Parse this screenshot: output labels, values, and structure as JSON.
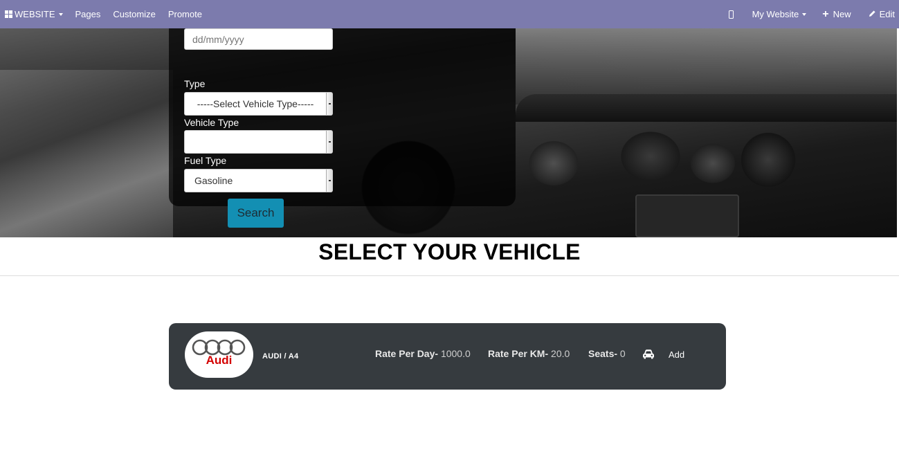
{
  "navbar": {
    "website_label": "WEBSITE",
    "pages_label": "Pages",
    "customize_label": "Customize",
    "promote_label": "Promote",
    "my_website_label": "My Website",
    "new_label": "New",
    "edit_label": "Edit",
    "background_color": "#7c7bad"
  },
  "search_form": {
    "date_placeholder": "dd/mm/yyyy",
    "type_label": "Type",
    "type_selected": "-----Select Vehicle Type-----",
    "vehicle_type_label": "Vehicle Type",
    "vehicle_type_selected": "",
    "fuel_type_label": "Fuel Type",
    "fuel_type_selected": "Gasoline",
    "search_button": "Search",
    "button_color": "#138fb3"
  },
  "section": {
    "title": "SELECT YOUR VEHICLE"
  },
  "vehicles": [
    {
      "logo_text": "Audi",
      "name": "AUDI / A4",
      "rate_per_day_label": "Rate Per Day-",
      "rate_per_day": "1000.0",
      "rate_per_km_label": "Rate Per KM-",
      "rate_per_km": "20.0",
      "seats_label": "Seats-",
      "seats": "0",
      "add_label": "Add"
    }
  ]
}
